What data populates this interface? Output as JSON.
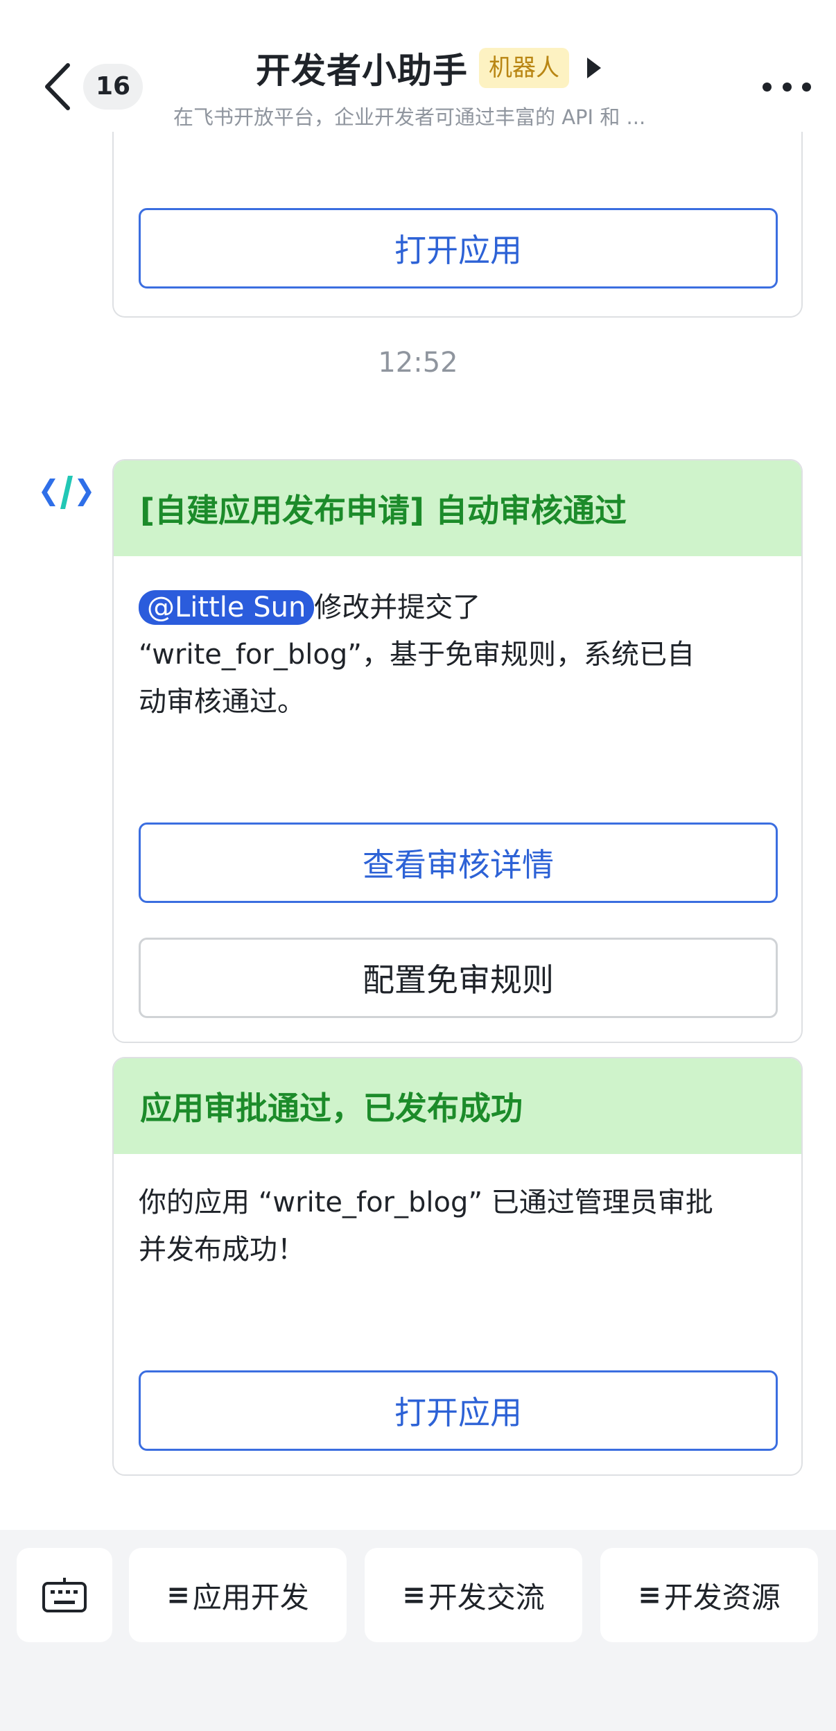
{
  "header": {
    "back_count": "16",
    "title": "开发者小助手",
    "tag": "机器人",
    "subtitle": "在飞书开放平台，企业开发者可通过丰富的 API 和 ..."
  },
  "partial_card": {
    "button_label": "打开应用"
  },
  "timestamp": "12:52",
  "review_card": {
    "header": "[自建应用发布申请] 自动审核通过",
    "mention": "@Little Sun",
    "body_line1_suffix": "修改并提交了",
    "body_line2": "“write_for_blog”，基于免审规则，系统已自",
    "body_line3": "动审核通过。",
    "primary_button": "查看审核详情",
    "secondary_button": "配置免审规则"
  },
  "approval_card": {
    "header": "应用审批通过，已发布成功",
    "body_line1": "你的应用 “write_for_blog” 已通过管理员审批",
    "body_line2": "并发布成功！",
    "button_label": "打开应用"
  },
  "bottom_menu": {
    "icon": "keyboard-icon",
    "items": [
      {
        "icon": "≡",
        "label": "应用开发"
      },
      {
        "icon": "≡",
        "label": "开发交流"
      },
      {
        "icon": "≡",
        "label": "开发资源"
      }
    ]
  },
  "colors": {
    "accent_blue": "#2d62d6",
    "card_header_green_bg": "#cff3cb",
    "card_header_green_text": "#1c8b2a",
    "tag_bg": "#fdf2c2",
    "tag_text": "#b98613"
  }
}
